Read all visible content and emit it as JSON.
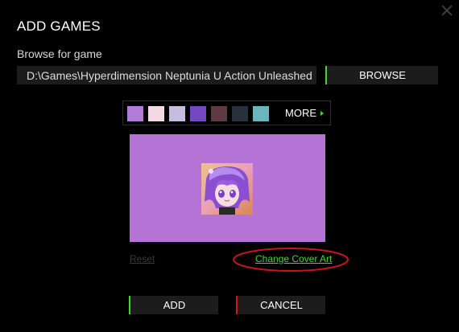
{
  "dialog": {
    "title": "ADD GAMES",
    "close_icon": "close-icon"
  },
  "browse": {
    "label": "Browse for game",
    "path_value": "D:\\Games\\Hyperdimension Neptunia U Action Unleashed",
    "button_label": "BROWSE"
  },
  "swatches": {
    "colors": [
      "#b27ad9",
      "#f2d9e3",
      "#c6bcdf",
      "#7448c0",
      "#5e3a45",
      "#27303d",
      "#6ab5be"
    ],
    "more_label": "MORE"
  },
  "cover": {
    "background_color": "#b574d5",
    "icon": "game-cover-icon"
  },
  "links": {
    "reset_label": "Reset",
    "change_cover_label": "Change Cover Art"
  },
  "actions": {
    "add_label": "ADD",
    "cancel_label": "CANCEL"
  },
  "colors": {
    "accent_green": "#44d62c",
    "cancel_red": "#d01818",
    "annotation_red": "#c8141c"
  }
}
